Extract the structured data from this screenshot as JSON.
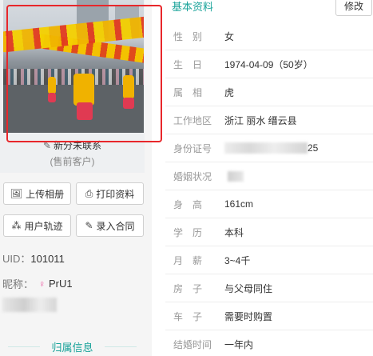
{
  "profile": {
    "relation_label": "新分未联系",
    "customer_type": "(售前客户)",
    "buttons": {
      "upload_album": "上传相册",
      "print_profile": "打印资料",
      "user_track": "用户轨迹",
      "enter_contract": "录入合同"
    },
    "uid_label": "UID：",
    "uid_value": "101011",
    "nickname_label": "昵称：",
    "nickname_value": "PrU1",
    "group_title": "归属信息"
  },
  "basic_info": {
    "title": "基本资料",
    "edit_label": "修改",
    "rows": [
      {
        "label": "性　别",
        "value": "女"
      },
      {
        "label": "生　日",
        "value": "1974-04-09（50岁）"
      },
      {
        "label": "属　相",
        "value": "虎"
      },
      {
        "label": "工作地区",
        "value": "浙江 丽水 缙云县"
      },
      {
        "label": "身份证号",
        "value": "25"
      },
      {
        "label": "婚姻状况",
        "value": ""
      },
      {
        "label": "身　高",
        "value": "161cm"
      },
      {
        "label": "学　历",
        "value": "本科"
      },
      {
        "label": "月　薪",
        "value": "3~4千"
      },
      {
        "label": "房　子",
        "value": "与父母同住"
      },
      {
        "label": "车　子",
        "value": "需要时购置"
      },
      {
        "label": "结婚时间",
        "value": "一年内"
      }
    ]
  },
  "colors": {
    "accent": "#1aa39a",
    "highlight_frame": "#e8272b"
  },
  "icons": {
    "relation": "pencil-icon",
    "upload_album": "image-icon",
    "print_profile": "printer-icon",
    "user_track": "network-icon",
    "enter_contract": "pen-icon",
    "nickname": "female-user-icon"
  }
}
